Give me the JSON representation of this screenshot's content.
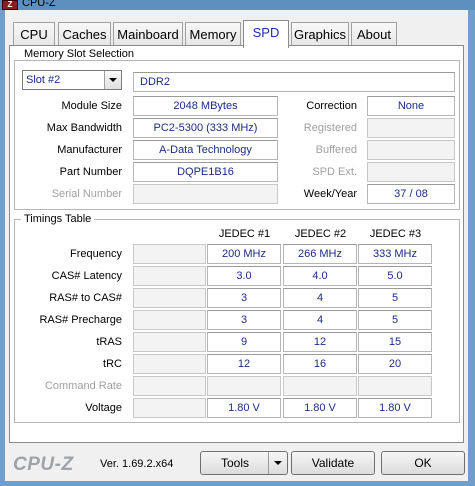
{
  "window": {
    "title": "CPU-Z",
    "icon_letter": "Z"
  },
  "tabs": [
    {
      "label": "CPU",
      "active": false
    },
    {
      "label": "Caches",
      "active": false
    },
    {
      "label": "Mainboard",
      "active": false
    },
    {
      "label": "Memory",
      "active": false
    },
    {
      "label": "SPD",
      "active": true
    },
    {
      "label": "Graphics",
      "active": false
    },
    {
      "label": "About",
      "active": false
    }
  ],
  "memory_slot": {
    "legend": "Memory Slot Selection",
    "slot_selected": "Slot #2",
    "memory_type": "DDR2",
    "module_size_label": "Module Size",
    "module_size": "2048 MBytes",
    "max_bandwidth_label": "Max Bandwidth",
    "max_bandwidth": "PC2-5300 (333 MHz)",
    "manufacturer_label": "Manufacturer",
    "manufacturer": "A-Data Technology",
    "part_number_label": "Part Number",
    "part_number": "DQPE1B16",
    "serial_number_label": "Serial Number",
    "serial_number": "",
    "correction_label": "Correction",
    "correction": "None",
    "registered_label": "Registered",
    "registered": "",
    "buffered_label": "Buffered",
    "buffered": "",
    "spd_ext_label": "SPD Ext.",
    "spd_ext": "",
    "week_year_label": "Week/Year",
    "week_year": "37 / 08"
  },
  "timings": {
    "legend": "Timings Table",
    "columns": [
      "JEDEC #1",
      "JEDEC #2",
      "JEDEC #3"
    ],
    "rows": [
      {
        "label": "Frequency",
        "values": [
          "200 MHz",
          "266 MHz",
          "333 MHz"
        ]
      },
      {
        "label": "CAS# Latency",
        "values": [
          "3.0",
          "4.0",
          "5.0"
        ]
      },
      {
        "label": "RAS# to CAS#",
        "values": [
          "3",
          "4",
          "5"
        ]
      },
      {
        "label": "RAS# Precharge",
        "values": [
          "3",
          "4",
          "5"
        ]
      },
      {
        "label": "tRAS",
        "values": [
          "9",
          "12",
          "15"
        ]
      },
      {
        "label": "tRC",
        "values": [
          "12",
          "16",
          "20"
        ]
      },
      {
        "label": "Command Rate",
        "values": [
          "",
          "",
          ""
        ]
      },
      {
        "label": "Voltage",
        "values": [
          "1.80 V",
          "1.80 V",
          "1.80 V"
        ]
      }
    ]
  },
  "footer": {
    "logo": "CPU-Z",
    "version": "Ver. 1.69.2.x64",
    "tools_label": "Tools",
    "validate_label": "Validate",
    "ok_label": "OK"
  }
}
